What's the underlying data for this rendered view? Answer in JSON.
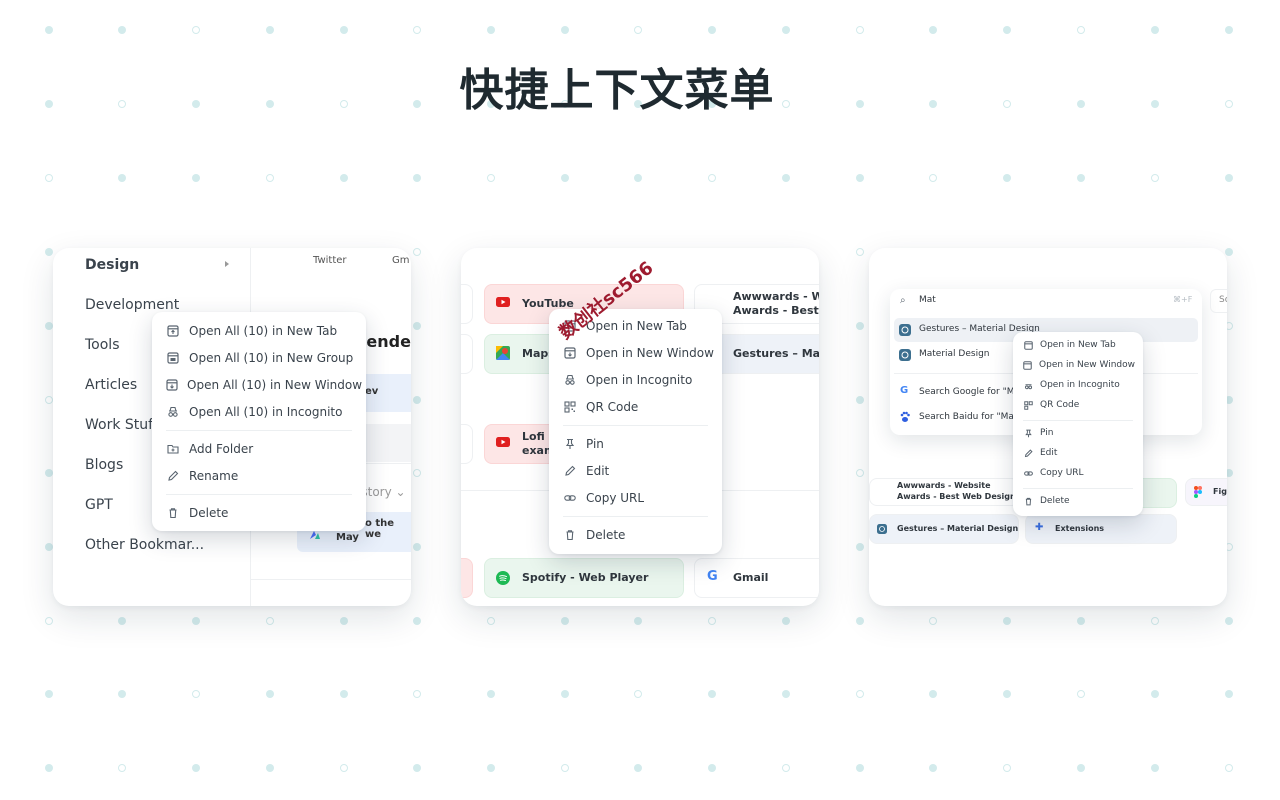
{
  "page": {
    "title": "快捷上下文菜单"
  },
  "colors": {
    "background": "#ffffff",
    "dot": "#d3ebec",
    "title": "#1f2a30",
    "watermark": "#9e1b2f"
  },
  "panel1": {
    "sidebar_items": [
      "Design",
      "Development",
      "Tools",
      "Articles",
      "Work Stuf",
      "Blogs",
      "GPT",
      "Other Bookmar..."
    ],
    "top_links": [
      "Twitter",
      "Gm"
    ],
    "heading": "nende",
    "card_text": "ev",
    "history_label": "History",
    "card3_line1": "o the we",
    "card3_line2": "May",
    "context_menu": {
      "items": [
        {
          "label": "Open All (10) in New Tab",
          "icon": "open-new-tab-icon"
        },
        {
          "label": "Open All (10) in New Group",
          "icon": "new-group-icon"
        },
        {
          "label": "Open All (10) in New Window",
          "icon": "new-window-icon"
        },
        {
          "label": "Open All (10) in Incognito",
          "icon": "incognito-icon"
        },
        {
          "label": "Add Folder",
          "icon": "add-folder-icon"
        },
        {
          "label": "Rename",
          "icon": "pencil-icon"
        },
        {
          "label": "Delete",
          "icon": "trash-icon"
        }
      ]
    }
  },
  "panel2": {
    "tiles": {
      "youtube": "YouTube",
      "awwwards_1": "Awwwards - Wel",
      "awwwards_2": "Awards - Best W",
      "maps": "Maps",
      "gestures": "Gestures – Mate",
      "lofi_1": "Lofi C",
      "lofi_2": "exam",
      "spotify": "Spotify - Web Player",
      "gmail": "Gmail"
    },
    "context_menu": {
      "items": [
        {
          "label": "Open in New Tab",
          "icon": "open-new-tab-icon"
        },
        {
          "label": "Open in New Window",
          "icon": "new-window-icon"
        },
        {
          "label": "Open in Incognito",
          "icon": "incognito-icon"
        },
        {
          "label": "QR Code",
          "icon": "qr-code-icon"
        },
        {
          "label": "Pin",
          "icon": "pin-icon"
        },
        {
          "label": "Edit",
          "icon": "pencil-icon"
        },
        {
          "label": "Copy URL",
          "icon": "link-icon"
        },
        {
          "label": "Delete",
          "icon": "trash-icon"
        }
      ]
    },
    "watermark": "数创社sc566"
  },
  "panel3": {
    "search": {
      "query": "Mat",
      "shortcut": "⌘+F",
      "side_tab": "Sc",
      "results": [
        "Gestures – Material Design",
        "Material Design"
      ],
      "engines": [
        "Search Google for \"Ma",
        "Search Baidu for \"Mat"
      ]
    },
    "tiles": {
      "awwwards_1": "Awwwards - Website",
      "awwwards_2": "Awards - Best Web Design...",
      "figma": "Fig",
      "gestures": "Gestures – Material Design",
      "extensions": "Extensions"
    },
    "context_menu": {
      "items": [
        {
          "label": "Open in New Tab",
          "icon": "open-new-tab-icon"
        },
        {
          "label": "Open in New Window",
          "icon": "new-window-icon"
        },
        {
          "label": "Open in Incognito",
          "icon": "incognito-icon"
        },
        {
          "label": "QR Code",
          "icon": "qr-code-icon"
        },
        {
          "label": "Pin",
          "icon": "pin-icon"
        },
        {
          "label": "Edit",
          "icon": "pencil-icon"
        },
        {
          "label": "Copy URL",
          "icon": "link-icon"
        },
        {
          "label": "Delete",
          "icon": "trash-icon"
        }
      ]
    }
  }
}
